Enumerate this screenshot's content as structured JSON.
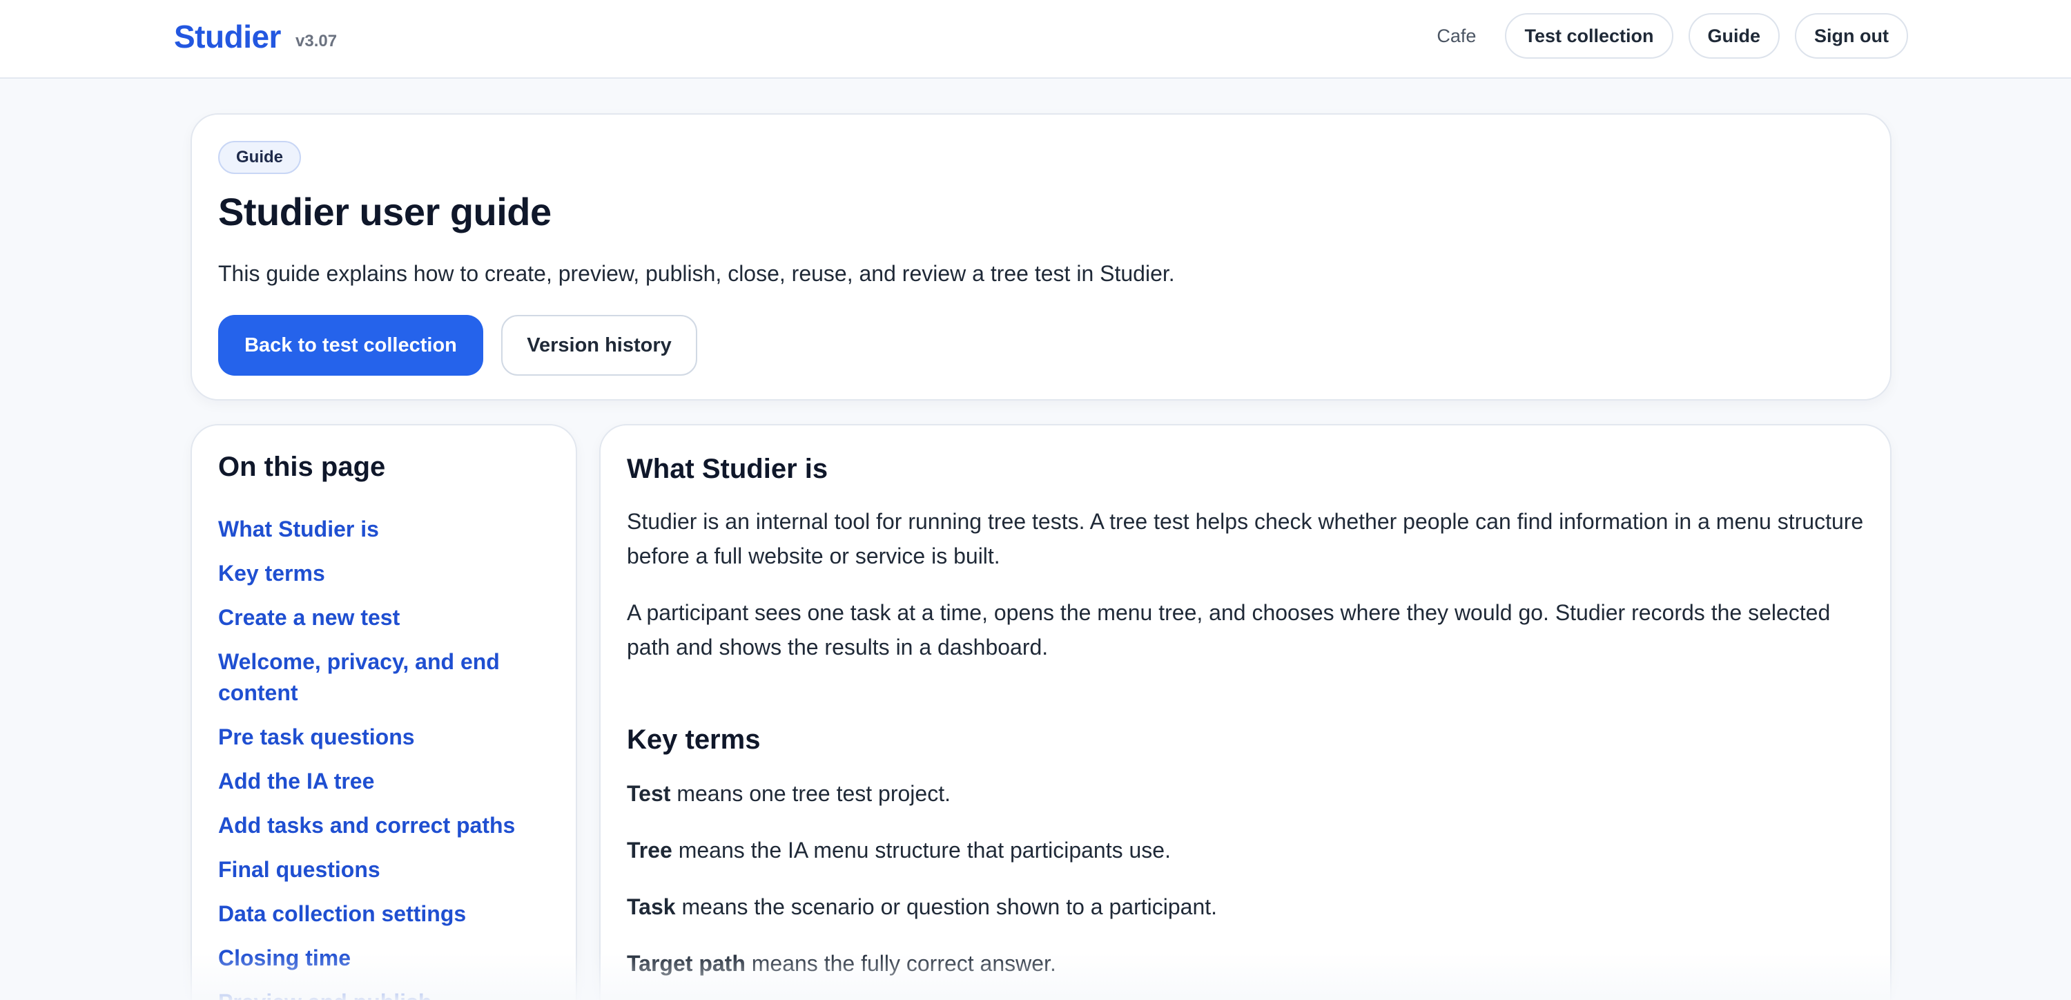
{
  "app": {
    "name": "Studier",
    "version": "v3.07"
  },
  "nav": {
    "user": "Cafe",
    "items": [
      {
        "label": "Test collection"
      },
      {
        "label": "Guide"
      },
      {
        "label": "Sign out"
      }
    ]
  },
  "hero": {
    "badge": "Guide",
    "title": "Studier user guide",
    "description": "This guide explains how to create, preview, publish, close, reuse, and review a tree test in Studier.",
    "primary_button": "Back to test collection",
    "secondary_button": "Version history"
  },
  "toc": {
    "heading": "On this page",
    "items": [
      {
        "label": "What Studier is"
      },
      {
        "label": "Key terms"
      },
      {
        "label": "Create a new test"
      },
      {
        "label": "Welcome, privacy, and end content"
      },
      {
        "label": "Pre task questions"
      },
      {
        "label": "Add the IA tree"
      },
      {
        "label": "Add tasks and correct paths"
      },
      {
        "label": "Final questions"
      },
      {
        "label": "Data collection settings"
      },
      {
        "label": "Closing time"
      },
      {
        "label": "Preview and publish"
      }
    ]
  },
  "content": {
    "section1": {
      "heading": "What Studier is",
      "paragraphs": [
        "Studier is an internal tool for running tree tests. A tree test helps check whether people can find information in a menu structure before a full website or service is built.",
        "A participant sees one task at a time, opens the menu tree, and chooses where they would go. Studier records the selected path and shows the results in a dashboard."
      ]
    },
    "section2": {
      "heading": "Key terms",
      "terms": [
        {
          "term": "Test",
          "definition": " means one tree test project."
        },
        {
          "term": "Tree",
          "definition": " means the IA menu structure that participants use."
        },
        {
          "term": "Task",
          "definition": " means the scenario or question shown to a participant."
        },
        {
          "term": "Target path",
          "definition": " means the fully correct answer."
        }
      ]
    }
  }
}
